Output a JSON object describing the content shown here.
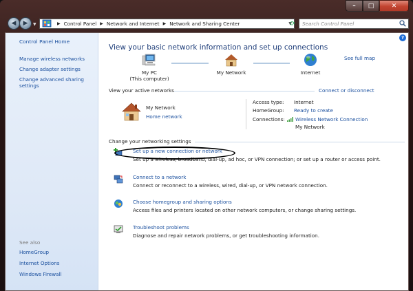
{
  "window": {
    "caption": {
      "minimize": "–",
      "maximize": "□",
      "close": "✕"
    }
  },
  "address_bar": {
    "crumbs": [
      "Control Panel",
      "Network and Internet",
      "Network and Sharing Center"
    ],
    "search_placeholder": "Search Control Panel"
  },
  "sidebar": {
    "home": "Control Panel Home",
    "links": [
      "Manage wireless networks",
      "Change adapter settings",
      "Change advanced sharing settings"
    ],
    "see_also_label": "See also",
    "see_also": [
      "HomeGroup",
      "Internet Options",
      "Windows Firewall"
    ]
  },
  "main": {
    "heading": "View your basic network information and set up connections",
    "see_full_map": "See full map",
    "map": {
      "pc_label": "My PC",
      "pc_sub": "(This computer)",
      "network_label": "My Network",
      "internet_label": "Internet"
    },
    "active_networks_label": "View your active networks",
    "connect_disconnect": "Connect or disconnect",
    "network_name": "My Network",
    "network_type": "Home network",
    "access_type_label": "Access type:",
    "access_type_value": "Internet",
    "homegroup_label": "HomeGroup:",
    "homegroup_value": "Ready to create",
    "connections_label": "Connections:",
    "connections_value": "Wireless Network Connection",
    "connections_sub": "My Network",
    "change_settings_label": "Change your networking settings",
    "tasks": [
      {
        "title": "Set up a new connection or network",
        "desc": "Set up a wireless, broadband, dial-up, ad hoc, or VPN connection; or set up a router or access point."
      },
      {
        "title": "Connect to a network",
        "desc": "Connect or reconnect to a wireless, wired, dial-up, or VPN network connection."
      },
      {
        "title": "Choose homegroup and sharing options",
        "desc": "Access files and printers located on other network computers, or change sharing settings."
      },
      {
        "title": "Troubleshoot problems",
        "desc": "Diagnose and repair network problems, or get troubleshooting information."
      }
    ]
  },
  "colors": {
    "link": "#1a4f9e",
    "heading": "#1f3e7a",
    "sidebar_bg": "#e3ecf8"
  }
}
